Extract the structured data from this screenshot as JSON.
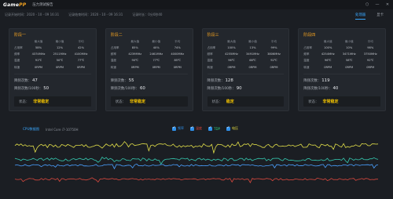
{
  "app": {
    "logo_main": "Game",
    "logo_accent": "PP",
    "window_title": "压力测试报告"
  },
  "window_controls": [
    "⬡",
    "—",
    "✕"
  ],
  "info": {
    "start_time": "记录开始时间：2020 - 10 - 09 16:31",
    "end_time": "记录结束时间：2020 - 10 - 09 16:31",
    "duration": "记录时长：0分0秒40"
  },
  "tabs": [
    {
      "label": "处理器",
      "active": true
    },
    {
      "label": "显卡",
      "active": false
    }
  ],
  "column_headers": [
    "最大值",
    "最小值",
    "平均"
  ],
  "cards": [
    {
      "title": "阶段一",
      "rows": [
        {
          "label": "占用率",
          "values": [
            "58%",
            "12%",
            "42%"
          ]
        },
        {
          "label": "频率",
          "values": [
            "4374MHz",
            "2511MHz",
            "4100MHz"
          ]
        },
        {
          "label": "温度",
          "values": [
            "91℃",
            "50℃",
            "77℃"
          ]
        },
        {
          "label": "转速",
          "values": [
            "0RPM",
            "0RPM",
            "0RPM"
          ]
        }
      ],
      "stats": [
        {
          "label": "降频次数：",
          "value": "47"
        },
        {
          "label": "降频次数/100秒：",
          "value": "50"
        }
      ],
      "state_label": "状态：",
      "state_value": "非常稳定"
    },
    {
      "title": "阶段二",
      "rows": [
        {
          "label": "占用率",
          "values": [
            "85%",
            "40%",
            "74%"
          ]
        },
        {
          "label": "频率",
          "values": [
            "4239MHz",
            "2461MHz",
            "4000MHz"
          ]
        },
        {
          "label": "温度",
          "values": [
            "90℃",
            "77℃",
            "85℃"
          ]
        },
        {
          "label": "转速",
          "values": [
            "0RPM",
            "0RPM",
            "0RPM"
          ]
        }
      ],
      "stats": [
        {
          "label": "降频次数：",
          "value": "55"
        },
        {
          "label": "降频次数/100秒：",
          "value": "60"
        }
      ],
      "state_label": "状态：",
      "state_value": "非常稳定"
    },
    {
      "title": "阶段三",
      "rows": [
        {
          "label": "占用率",
          "values": [
            "100%",
            "13%",
            "99%"
          ]
        },
        {
          "label": "频率",
          "values": [
            "4255MHz",
            "3491MHz",
            "3806MHz"
          ]
        },
        {
          "label": "温度",
          "values": [
            "96℃",
            "68℃",
            "92℃"
          ]
        },
        {
          "label": "转速",
          "values": [
            "0RPM",
            "0RPM",
            "0RPM"
          ]
        }
      ],
      "stats": [
        {
          "label": "降频次数：",
          "value": "128"
        },
        {
          "label": "降频次数/100秒：",
          "value": "90"
        }
      ],
      "state_label": "状态：",
      "state_value": "稳定"
    },
    {
      "title": "阶段四",
      "rows": [
        {
          "label": "占用率",
          "values": [
            "100%",
            "10%",
            "98%"
          ]
        },
        {
          "label": "频率",
          "values": [
            "4254MHz",
            "3471MHz",
            "3750MHz"
          ]
        },
        {
          "label": "温度",
          "values": [
            "96℃",
            "58℃",
            "92℃"
          ]
        },
        {
          "label": "转速",
          "values": [
            "0RPM",
            "0RPM",
            "0RPM"
          ]
        }
      ],
      "stats": [
        {
          "label": "降频次数：",
          "value": "119"
        },
        {
          "label": "降频次数/100秒：",
          "value": "40"
        }
      ],
      "state_label": "状态：",
      "state_value": "非常稳定"
    }
  ],
  "chart": {
    "title": "CPU数据图",
    "cpu_name": "Intel Core i7-10750H",
    "legend": [
      {
        "label": "频率",
        "color": "#2f8fe8"
      },
      {
        "label": "温度",
        "color": "#e0453a"
      },
      {
        "label": "TDP",
        "color": "#2fd07a"
      },
      {
        "label": "电压",
        "color": "#e8e040"
      }
    ]
  },
  "chart_data": {
    "type": "line",
    "series": [
      {
        "name": "电压",
        "color": "#e2df49",
        "level": 0.16,
        "noise": 0.07
      },
      {
        "name": "TDP",
        "color": "#35c9b0",
        "level": 0.4,
        "noise": 0.05
      },
      {
        "name": "频率",
        "color": "#4aa0ff",
        "level": 0.5,
        "noise": 0.03
      },
      {
        "name": "温度",
        "color": "#d8483e",
        "level": 0.74,
        "noise": 0.03
      }
    ]
  }
}
